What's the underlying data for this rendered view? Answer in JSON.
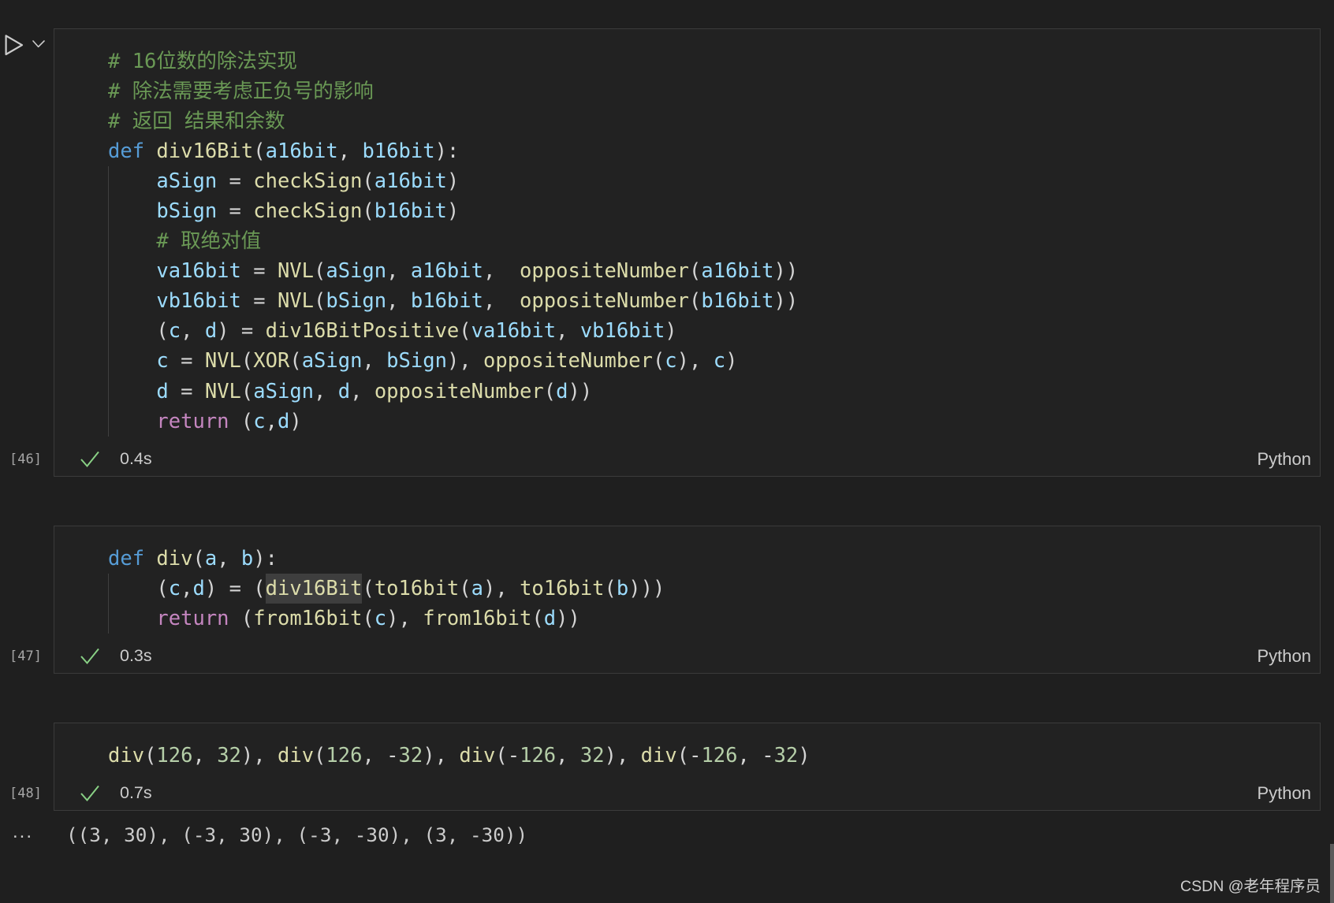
{
  "theme": {
    "success": "#89d185",
    "icon": "#cccccc"
  },
  "toolbar": {
    "run_icon": "play-icon",
    "run_menu_icon": "chevron-down-icon"
  },
  "cells": [
    {
      "execution_count": "[46]",
      "status": {
        "icon": "check-icon",
        "duration": "0.4s"
      },
      "language": "Python",
      "code": [
        [
          [
            "# 16位数的除法实现",
            "#6a9955"
          ]
        ],
        [
          [
            "# 除法需要考虑正负号的影响",
            "#6a9955"
          ]
        ],
        [
          [
            "# 返回 结果和余数",
            "#6a9955"
          ]
        ],
        [
          [
            "def",
            "#569cd6"
          ],
          [
            " ",
            "#d4d4d4"
          ],
          [
            "div16Bit",
            "#dcdcaa"
          ],
          [
            "(",
            "#d4d4d4"
          ],
          [
            "a16bit",
            "#9cdcfe"
          ],
          [
            ", ",
            "#d4d4d4"
          ],
          [
            "b16bit",
            "#9cdcfe"
          ],
          [
            "):",
            "#d4d4d4"
          ]
        ],
        [
          [
            "    ",
            "#404040"
          ],
          [
            "aSign",
            "#9cdcfe"
          ],
          [
            " = ",
            "#d4d4d4"
          ],
          [
            "checkSign",
            "#dcdcaa"
          ],
          [
            "(",
            "#d4d4d4"
          ],
          [
            "a16bit",
            "#9cdcfe"
          ],
          [
            ")",
            "#d4d4d4"
          ]
        ],
        [
          [
            "    ",
            "#404040"
          ],
          [
            "bSign",
            "#9cdcfe"
          ],
          [
            " = ",
            "#d4d4d4"
          ],
          [
            "checkSign",
            "#dcdcaa"
          ],
          [
            "(",
            "#d4d4d4"
          ],
          [
            "b16bit",
            "#9cdcfe"
          ],
          [
            ")",
            "#d4d4d4"
          ]
        ],
        [
          [
            "    ",
            "#404040"
          ],
          [
            "# 取绝对值",
            "#6a9955"
          ]
        ],
        [
          [
            "    ",
            "#404040"
          ],
          [
            "va16bit",
            "#9cdcfe"
          ],
          [
            " = ",
            "#d4d4d4"
          ],
          [
            "NVL",
            "#dcdcaa"
          ],
          [
            "(",
            "#d4d4d4"
          ],
          [
            "aSign",
            "#9cdcfe"
          ],
          [
            ", ",
            "#d4d4d4"
          ],
          [
            "a16bit",
            "#9cdcfe"
          ],
          [
            ",  ",
            "#d4d4d4"
          ],
          [
            "oppositeNumber",
            "#dcdcaa"
          ],
          [
            "(",
            "#d4d4d4"
          ],
          [
            "a16bit",
            "#9cdcfe"
          ],
          [
            "))",
            "#d4d4d4"
          ]
        ],
        [
          [
            "    ",
            "#404040"
          ],
          [
            "vb16bit",
            "#9cdcfe"
          ],
          [
            " = ",
            "#d4d4d4"
          ],
          [
            "NVL",
            "#dcdcaa"
          ],
          [
            "(",
            "#d4d4d4"
          ],
          [
            "bSign",
            "#9cdcfe"
          ],
          [
            ", ",
            "#d4d4d4"
          ],
          [
            "b16bit",
            "#9cdcfe"
          ],
          [
            ",  ",
            "#d4d4d4"
          ],
          [
            "oppositeNumber",
            "#dcdcaa"
          ],
          [
            "(",
            "#d4d4d4"
          ],
          [
            "b16bit",
            "#9cdcfe"
          ],
          [
            "))",
            "#d4d4d4"
          ]
        ],
        [
          [
            "    ",
            "#404040"
          ],
          [
            "(",
            "#d4d4d4"
          ],
          [
            "c",
            "#9cdcfe"
          ],
          [
            ", ",
            "#d4d4d4"
          ],
          [
            "d",
            "#9cdcfe"
          ],
          [
            ") = ",
            "#d4d4d4"
          ],
          [
            "div16BitPositive",
            "#dcdcaa"
          ],
          [
            "(",
            "#d4d4d4"
          ],
          [
            "va16bit",
            "#9cdcfe"
          ],
          [
            ", ",
            "#d4d4d4"
          ],
          [
            "vb16bit",
            "#9cdcfe"
          ],
          [
            ")",
            "#d4d4d4"
          ]
        ],
        [
          [
            "    ",
            "#404040"
          ],
          [
            "c",
            "#9cdcfe"
          ],
          [
            " = ",
            "#d4d4d4"
          ],
          [
            "NVL",
            "#dcdcaa"
          ],
          [
            "(",
            "#d4d4d4"
          ],
          [
            "XOR",
            "#dcdcaa"
          ],
          [
            "(",
            "#d4d4d4"
          ],
          [
            "aSign",
            "#9cdcfe"
          ],
          [
            ", ",
            "#d4d4d4"
          ],
          [
            "bSign",
            "#9cdcfe"
          ],
          [
            "), ",
            "#d4d4d4"
          ],
          [
            "oppositeNumber",
            "#dcdcaa"
          ],
          [
            "(",
            "#d4d4d4"
          ],
          [
            "c",
            "#9cdcfe"
          ],
          [
            "), ",
            "#d4d4d4"
          ],
          [
            "c",
            "#9cdcfe"
          ],
          [
            ")",
            "#d4d4d4"
          ]
        ],
        [
          [
            "    ",
            "#404040"
          ],
          [
            "d",
            "#9cdcfe"
          ],
          [
            " = ",
            "#d4d4d4"
          ],
          [
            "NVL",
            "#dcdcaa"
          ],
          [
            "(",
            "#d4d4d4"
          ],
          [
            "aSign",
            "#9cdcfe"
          ],
          [
            ", ",
            "#d4d4d4"
          ],
          [
            "d",
            "#9cdcfe"
          ],
          [
            ", ",
            "#d4d4d4"
          ],
          [
            "oppositeNumber",
            "#dcdcaa"
          ],
          [
            "(",
            "#d4d4d4"
          ],
          [
            "d",
            "#9cdcfe"
          ],
          [
            "))",
            "#d4d4d4"
          ]
        ],
        [
          [
            "    ",
            "#404040"
          ],
          [
            "return",
            "#c586c0"
          ],
          [
            " (",
            "#d4d4d4"
          ],
          [
            "c",
            "#9cdcfe"
          ],
          [
            ",",
            "#d4d4d4"
          ],
          [
            "d",
            "#9cdcfe"
          ],
          [
            ")",
            "#d4d4d4"
          ]
        ]
      ]
    },
    {
      "execution_count": "[47]",
      "status": {
        "icon": "check-icon",
        "duration": "0.3s"
      },
      "language": "Python",
      "code": [
        [
          [
            "def",
            "#569cd6"
          ],
          [
            " ",
            "#d4d4d4"
          ],
          [
            "div",
            "#dcdcaa"
          ],
          [
            "(",
            "#d4d4d4"
          ],
          [
            "a",
            "#9cdcfe"
          ],
          [
            ", ",
            "#d4d4d4"
          ],
          [
            "b",
            "#9cdcfe"
          ],
          [
            "):",
            "#d4d4d4"
          ]
        ],
        [
          [
            "    ",
            "#404040"
          ],
          [
            "(",
            "#d4d4d4"
          ],
          [
            "c",
            "#9cdcfe"
          ],
          [
            ",",
            "#d4d4d4"
          ],
          [
            "d",
            "#9cdcfe"
          ],
          [
            ") = (",
            "#d4d4d4"
          ],
          [
            "div16Bit",
            "#dcdcaa",
            "#3e3e3e"
          ],
          [
            "(",
            "#d4d4d4"
          ],
          [
            "to16bit",
            "#dcdcaa"
          ],
          [
            "(",
            "#d4d4d4"
          ],
          [
            "a",
            "#9cdcfe"
          ],
          [
            "), ",
            "#d4d4d4"
          ],
          [
            "to16bit",
            "#dcdcaa"
          ],
          [
            "(",
            "#d4d4d4"
          ],
          [
            "b",
            "#9cdcfe"
          ],
          [
            ")))",
            "#d4d4d4"
          ]
        ],
        [
          [
            "    ",
            "#404040"
          ],
          [
            "return",
            "#c586c0"
          ],
          [
            " (",
            "#d4d4d4"
          ],
          [
            "from16bit",
            "#dcdcaa"
          ],
          [
            "(",
            "#d4d4d4"
          ],
          [
            "c",
            "#9cdcfe"
          ],
          [
            "), ",
            "#d4d4d4"
          ],
          [
            "from16bit",
            "#dcdcaa"
          ],
          [
            "(",
            "#d4d4d4"
          ],
          [
            "d",
            "#9cdcfe"
          ],
          [
            "))",
            "#d4d4d4"
          ]
        ]
      ]
    },
    {
      "execution_count": "[48]",
      "status": {
        "icon": "check-icon",
        "duration": "0.7s"
      },
      "language": "Python",
      "code": [
        [
          [
            "div",
            "#dcdcaa"
          ],
          [
            "(",
            "#d4d4d4"
          ],
          [
            "126",
            "#b5cea8"
          ],
          [
            ", ",
            "#d4d4d4"
          ],
          [
            "32",
            "#b5cea8"
          ],
          [
            "), ",
            "#d4d4d4"
          ],
          [
            "div",
            "#dcdcaa"
          ],
          [
            "(",
            "#d4d4d4"
          ],
          [
            "126",
            "#b5cea8"
          ],
          [
            ", -",
            "#d4d4d4"
          ],
          [
            "32",
            "#b5cea8"
          ],
          [
            "), ",
            "#d4d4d4"
          ],
          [
            "div",
            "#dcdcaa"
          ],
          [
            "(-",
            "#d4d4d4"
          ],
          [
            "126",
            "#b5cea8"
          ],
          [
            ", ",
            "#d4d4d4"
          ],
          [
            "32",
            "#b5cea8"
          ],
          [
            "), ",
            "#d4d4d4"
          ],
          [
            "div",
            "#dcdcaa"
          ],
          [
            "(-",
            "#d4d4d4"
          ],
          [
            "126",
            "#b5cea8"
          ],
          [
            ", -",
            "#d4d4d4"
          ],
          [
            "32",
            "#b5cea8"
          ],
          [
            ")",
            "#d4d4d4"
          ]
        ]
      ]
    }
  ],
  "output": {
    "prompt": "...",
    "text": "((3, 30), (-3, 30), (-3, -30), (3, -30))"
  },
  "watermark": "CSDN @老年程序员"
}
